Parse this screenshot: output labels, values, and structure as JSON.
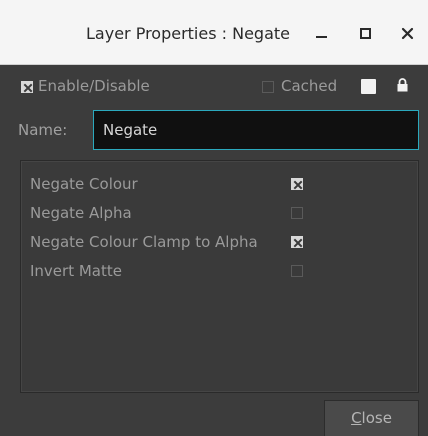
{
  "window": {
    "title": "Layer Properties : Negate"
  },
  "header": {
    "enable_label": "Enable/Disable",
    "enable_checked": true,
    "cached_label": "Cached",
    "cached_checked": false,
    "icons": [
      "color-swatch",
      "lock-icon"
    ]
  },
  "name_field": {
    "label": "Name:",
    "value": "Negate"
  },
  "options": [
    {
      "label": "Negate Colour",
      "checked": true
    },
    {
      "label": "Negate Alpha",
      "checked": false
    },
    {
      "label": "Negate Colour Clamp to Alpha",
      "checked": true
    },
    {
      "label": "Invert Matte",
      "checked": false
    }
  ],
  "footer": {
    "close_first": "C",
    "close_rest": "lose"
  },
  "colors": {
    "background": "#3c3c3c",
    "titlebar": "#f5f5f5",
    "input_border": "#2ba9bd",
    "text": "#9a9a9a"
  }
}
